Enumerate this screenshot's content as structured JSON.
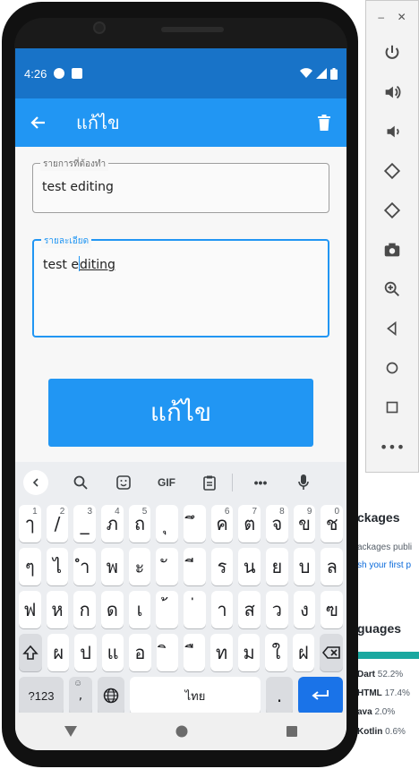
{
  "status_bar": {
    "time": "4:26"
  },
  "app_bar": {
    "title": "แก้ไข"
  },
  "form": {
    "field1": {
      "label": "รายการที่ต้องทำ",
      "value": "test editing"
    },
    "field2": {
      "label": "รายละเอียด",
      "value_before_caret": "test e",
      "value_after_caret": "diting"
    }
  },
  "primary_button": {
    "label": "แก้ไข"
  },
  "keyboard": {
    "toolbar": {
      "gif_label": "GIF"
    },
    "row1": [
      {
        "k": "ๅ",
        "h": "1"
      },
      {
        "k": "/",
        "h": "2"
      },
      {
        "k": "_",
        "h": "3"
      },
      {
        "k": "ภ",
        "h": "4"
      },
      {
        "k": "ถ",
        "h": "5"
      },
      {
        "k": "ุ",
        "h": ""
      },
      {
        "k": "ึ",
        "h": ""
      },
      {
        "k": "ค",
        "h": "6"
      },
      {
        "k": "ต",
        "h": "7"
      },
      {
        "k": "จ",
        "h": "8"
      },
      {
        "k": "ข",
        "h": "9"
      },
      {
        "k": "ช",
        "h": "0"
      }
    ],
    "row2": [
      "ๆ",
      "ไ",
      "ำ",
      "พ",
      "ะ",
      "ั",
      "ี",
      "ร",
      "น",
      "ย",
      "บ",
      "ล"
    ],
    "row3": [
      "ฟ",
      "ห",
      "ก",
      "ด",
      "เ",
      "้",
      "่",
      "า",
      "ส",
      "ว",
      "ง",
      "ฃ"
    ],
    "row4": [
      "ผ",
      "ป",
      "แ",
      "อ",
      "ิ",
      "ื",
      "ท",
      "ม",
      "ใ",
      "ฝ"
    ],
    "row5": {
      "symbols": "?123",
      "comma": ",",
      "space": "ไทย",
      "period": "."
    }
  },
  "desktop_bg": {
    "headings": {
      "packages": "ckages",
      "languages": "guages"
    },
    "packages_text": "ackages publi",
    "packages_link": "sh your first p",
    "languages": [
      {
        "name": "Dart",
        "pct": "52.2%"
      },
      {
        "name": "HTML",
        "pct": "17.4%"
      },
      {
        "name": "ava",
        "pct": "2.0%"
      },
      {
        "name": "Kotlin",
        "pct": "0.6%"
      }
    ]
  },
  "colors": {
    "primary": "#2196f3",
    "status": "#1873c8",
    "enter": "#1a73e8"
  }
}
